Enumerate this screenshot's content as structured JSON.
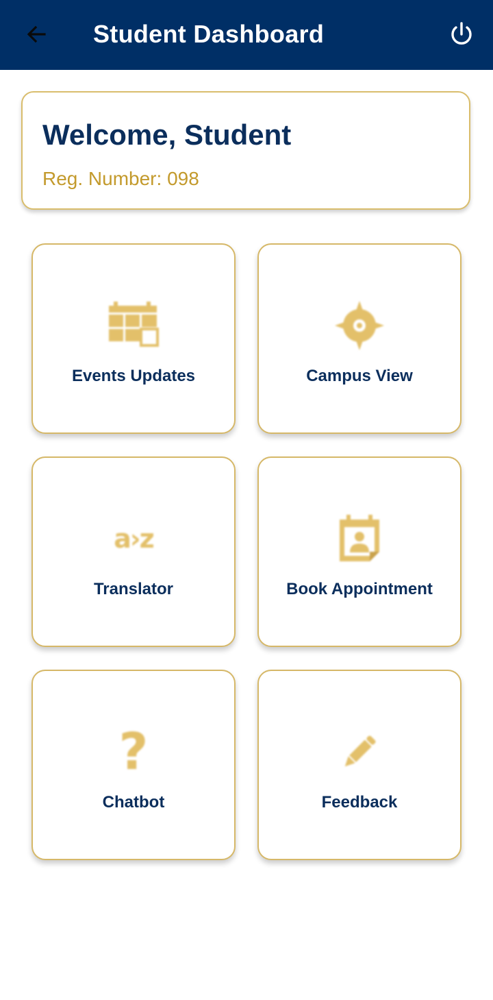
{
  "header": {
    "title": "Student Dashboard",
    "back_icon": "arrow-left-icon",
    "power_icon": "power-icon",
    "background_color": "#002f66"
  },
  "welcome": {
    "title": "Welcome, Student",
    "reg_number": "Reg. Number: 098"
  },
  "colors": {
    "accent": "#e3c06a",
    "text_primary": "#0b2e5c",
    "border": "#d6b868"
  },
  "tiles": [
    {
      "label": "Events Updates",
      "icon": "calendar-grid-icon"
    },
    {
      "label": "Campus View",
      "icon": "compass-target-icon"
    },
    {
      "label": "Translator",
      "icon": "a-to-z-translate-icon"
    },
    {
      "label": "Book Appointment",
      "icon": "contact-calendar-icon"
    },
    {
      "label": "Chatbot",
      "icon": "question-mark-icon"
    },
    {
      "label": "Feedback",
      "icon": "pencil-icon"
    }
  ]
}
